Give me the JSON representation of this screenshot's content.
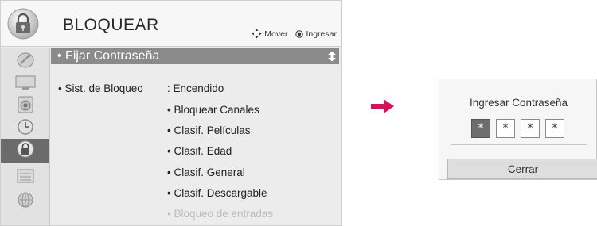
{
  "header": {
    "title": "BLOQUEAR",
    "hint_move": "Mover",
    "hint_enter": "Ingresar",
    "icon": "lock-icon"
  },
  "sidebar": {
    "icons": [
      "satellite-dish-icon",
      "tv-screen-icon",
      "speaker-icon",
      "clock-icon",
      "lock-icon",
      "options-icon",
      "network-icon"
    ],
    "active": "lock-icon"
  },
  "menu": {
    "items": [
      {
        "label": "• Fijar Contraseña",
        "selected": true
      },
      {
        "label": "• Sist. de Bloqueo",
        "selected": false
      }
    ],
    "lock_system_value": ": Encendido",
    "lock_options": [
      "• Bloquear Canales",
      "• Clasif. Películas",
      "• Clasif. Edad",
      "• Clasif. General",
      "• Clasif. Descargable",
      "• Bloqueo de entradas"
    ]
  },
  "dialog": {
    "title": "Ingresar Contraseña",
    "pin": [
      "*",
      "*",
      "*",
      "*"
    ],
    "close_label": "Cerrar"
  },
  "colors": {
    "arrow": "#d1135a",
    "selected_row": "#8a8a8a",
    "active_sidebar": "#6b6b6b"
  }
}
